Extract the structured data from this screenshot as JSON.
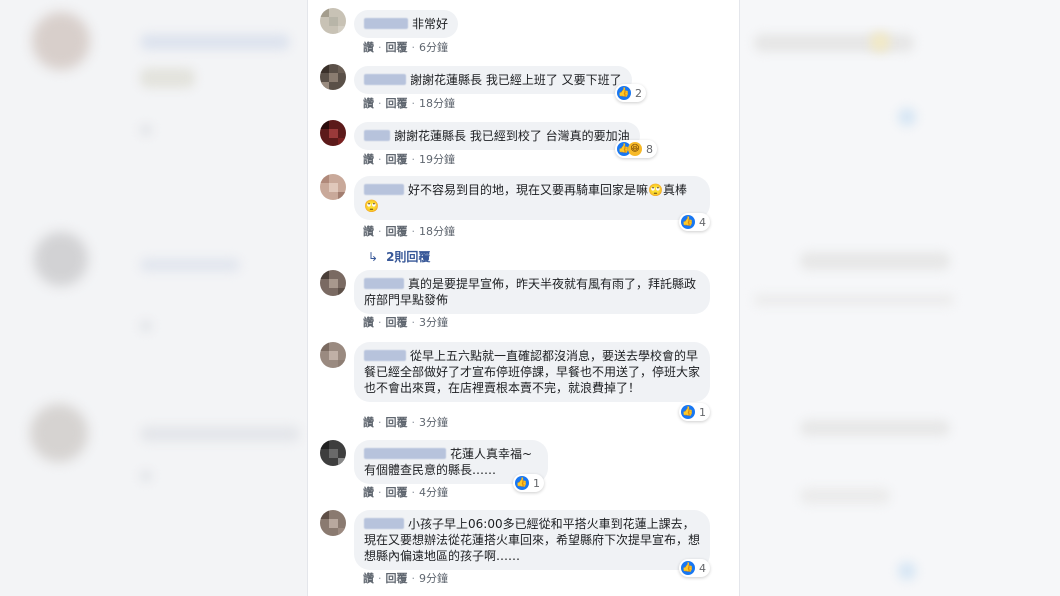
{
  "actions": {
    "like": "讚",
    "reply": "回覆",
    "dot": "·"
  },
  "comments": [
    {
      "text": "非常好",
      "time": "6分鐘",
      "reactions": ""
    },
    {
      "text": "謝謝花蓮縣長 我已經上班了 又要下班了",
      "time": "18分鐘",
      "reactions": "2"
    },
    {
      "text": "謝謝花蓮縣長 我已經到校了 台灣真的要加油",
      "time": "19分鐘",
      "reactions": "8"
    },
    {
      "text": "好不容易到目的地，現在又要再騎車回家是嘛🙄真棒🙄",
      "time": "18分鐘",
      "reactions": "4"
    },
    {
      "text": "真的是要提早宣佈，昨天半夜就有風有雨了，拜託縣政府部門早點發佈",
      "time": "3分鐘",
      "reactions": ""
    },
    {
      "text": "從早上五六點就一直確認都沒消息，要送去學校會的早餐已經全部做好了才宣布停班停課，早餐也不用送了，停班大家也不會出來買，在店裡賣根本賣不完，就浪費掉了！",
      "time": "3分鐘",
      "reactions": "1"
    },
    {
      "text": "花蓮人真幸福~ 有個體查民意的縣長……",
      "time": "4分鐘",
      "reactions": "1"
    },
    {
      "text": "小孩子早上06:00多已經從和平搭火車到花蓮上課去，現在又要想辦法從花蓮搭火車回來，希望縣府下次提早宣布，想想縣內偏遠地區的孩子啊……",
      "time": "9分鐘",
      "reactions": "4"
    }
  ],
  "replies_link": {
    "arrow": "↳",
    "label": "2則回覆"
  },
  "colors": {
    "link": "#385898",
    "like": "#1877f2",
    "bubble": "#f0f2f5"
  }
}
